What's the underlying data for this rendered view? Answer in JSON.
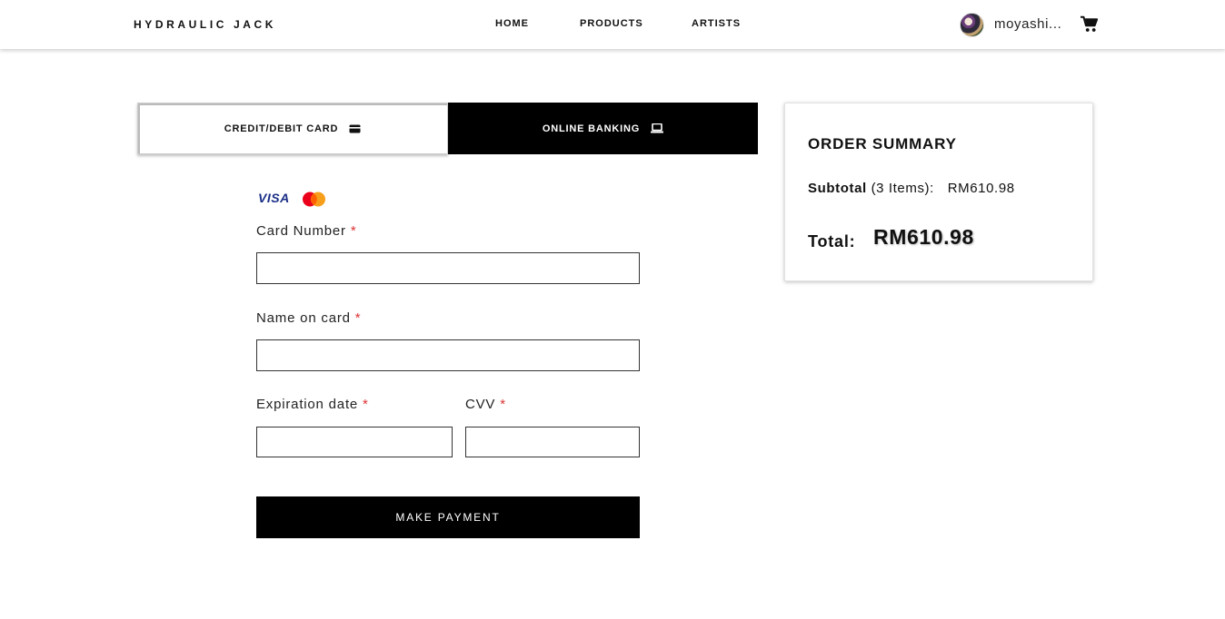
{
  "header": {
    "brand": "HYDRAULIC JACK",
    "nav": [
      "HOME",
      "PRODUCTS",
      "ARTISTS"
    ],
    "username": "moyashi...",
    "icons": {
      "avatar": "user-avatar",
      "cart": "shopping-cart-icon"
    }
  },
  "tabs": {
    "card": {
      "label": "CREDIT/DEBIT CARD",
      "icon": "credit-card-icon",
      "active": false
    },
    "bank": {
      "label": "ONLINE BANKING",
      "icon": "laptop-icon",
      "active": true
    }
  },
  "card_logos": {
    "visa": "VISA",
    "mastercard": "mastercard-logo"
  },
  "form": {
    "card_number": {
      "label": "Card Number",
      "required_mark": "*",
      "value": "",
      "placeholder": ""
    },
    "name_on_card": {
      "label": "Name on card",
      "required_mark": "*",
      "value": "",
      "placeholder": ""
    },
    "expiration": {
      "label": "Expiration date",
      "required_mark": "*",
      "value": "",
      "placeholder": ""
    },
    "cvv": {
      "label": "CVV",
      "required_mark": "*",
      "value": "",
      "placeholder": ""
    },
    "submit_label": "MAKE PAYMENT"
  },
  "summary": {
    "title": "ORDER SUMMARY",
    "subtotal_label": "Subtotal",
    "items_text": "(3 Items):",
    "subtotal_value": "RM610.98",
    "total_label": "Total:",
    "total_value": "RM610.98"
  },
  "colors": {
    "primary": "#000000",
    "required": "#dd3333",
    "visa": "#1a2e86",
    "mastercard_red": "#eb001b",
    "mastercard_orange": "#f79e1b"
  }
}
